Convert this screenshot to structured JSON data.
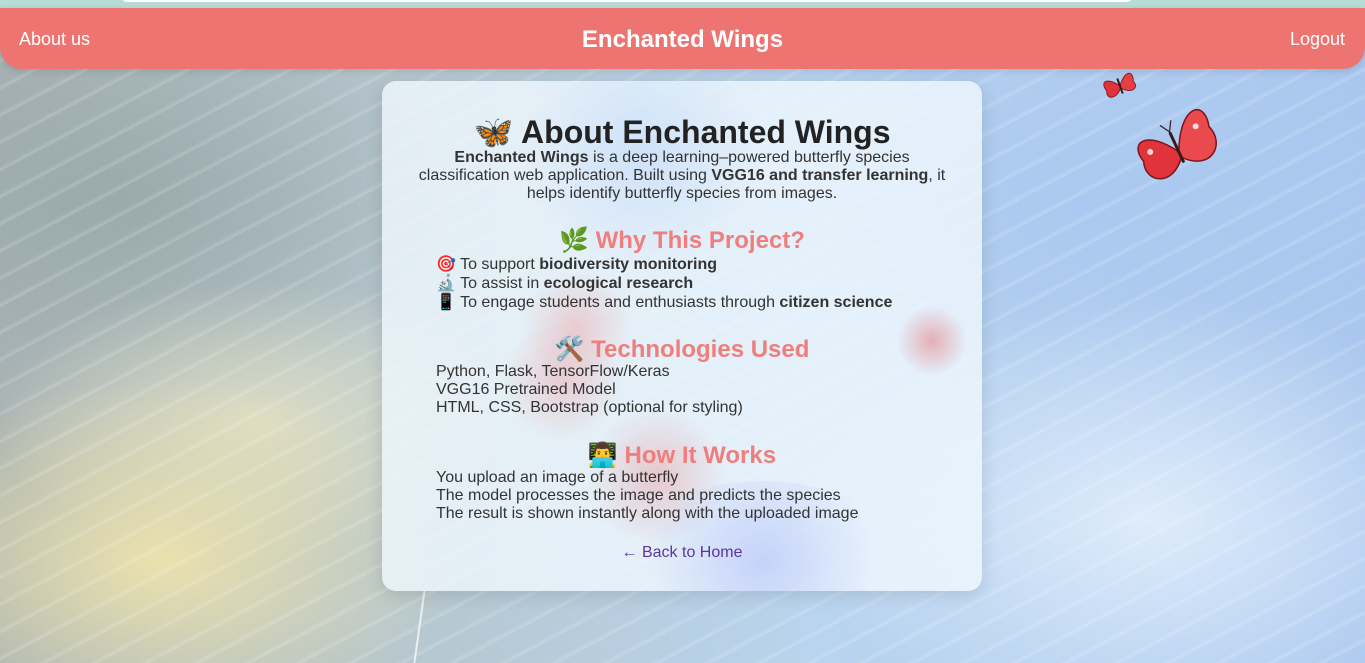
{
  "nav": {
    "left_link": "About us",
    "title": "Enchanted Wings",
    "right_link": "Logout"
  },
  "card": {
    "heading": "🦋 About Enchanted Wings",
    "intro": {
      "brand": "Enchanted Wings",
      "text1": " is a deep learning–powered butterfly species classification web application. Built using ",
      "tech": "VGG16 and transfer learning",
      "text2": ", it helps identify butterfly species from images."
    },
    "why": {
      "emoji": "🌿",
      "title": "Why This Project?",
      "items": [
        {
          "icon": "🎯",
          "prefix": "To support ",
          "bold": "biodiversity monitoring"
        },
        {
          "icon": "🔬",
          "prefix": "To assist in ",
          "bold": "ecological research"
        },
        {
          "icon": "📱",
          "prefix": "To engage students and enthusiasts through ",
          "bold": "citizen science"
        }
      ]
    },
    "tech": {
      "emoji": "🛠️",
      "title": "Technologies Used",
      "items": [
        "Python, Flask, TensorFlow/Keras",
        "VGG16 Pretrained Model",
        "HTML, CSS, Bootstrap (optional for styling)"
      ]
    },
    "how": {
      "emoji": "👨‍💻",
      "title": "How It Works",
      "items": [
        "You upload an image of a butterfly",
        "The model processes the image and predicts the species",
        "The result is shown instantly along with the uploaded image"
      ]
    },
    "back_link": "← Back to Home"
  },
  "colors": {
    "navbar": "#ee7472",
    "section_title": "#ef7e7c",
    "link": "#5b35a0"
  }
}
